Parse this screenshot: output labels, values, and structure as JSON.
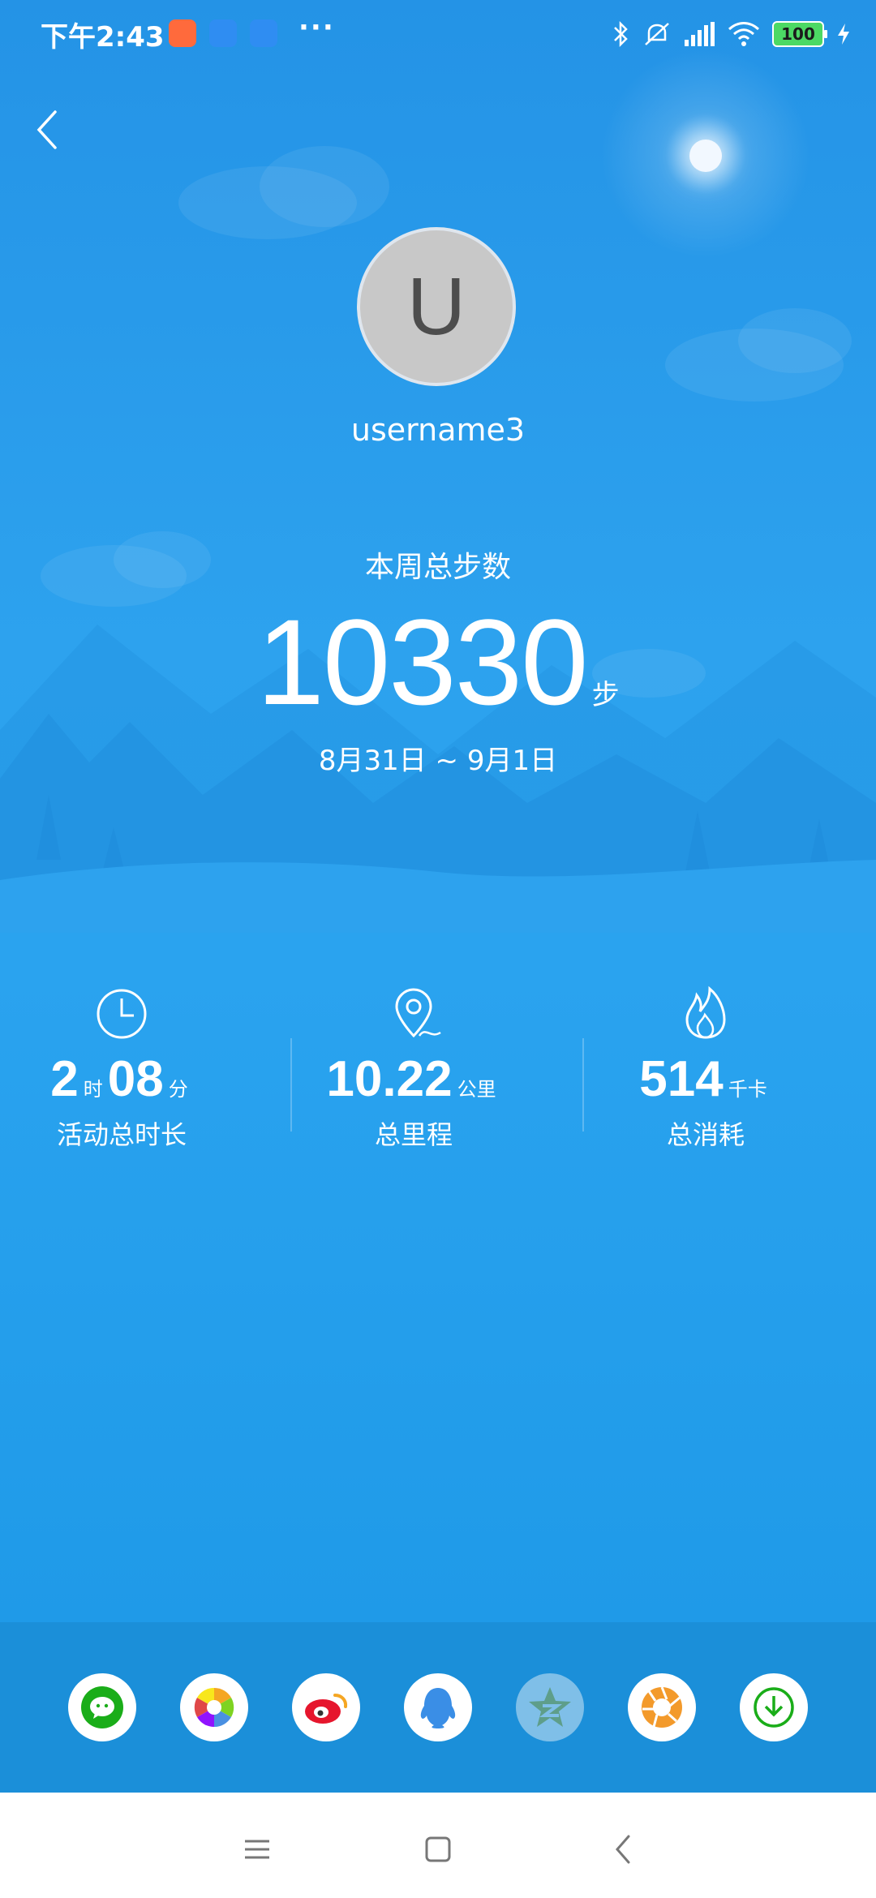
{
  "status_bar": {
    "time": "下午2:43",
    "battery": "100"
  },
  "profile": {
    "avatar_letter": "U",
    "username": "username3"
  },
  "summary": {
    "title": "本周总步数",
    "steps": "10330",
    "steps_unit": "步",
    "date_range": "8月31日 ~ 9月1日"
  },
  "stats": {
    "duration": {
      "hours": "2",
      "hours_unit": "时",
      "minutes": "08",
      "minutes_unit": "分",
      "label": "活动总时长"
    },
    "distance": {
      "value": "10.22",
      "unit": "公里",
      "label": "总里程"
    },
    "calories": {
      "value": "514",
      "unit": "千卡",
      "label": "总消耗"
    }
  },
  "share": [
    "wechat-icon",
    "moments-icon",
    "weibo-icon",
    "qq-icon",
    "qzone-icon",
    "camera-aperture-icon",
    "download-icon"
  ],
  "colors": {
    "background": "#2aa3ef",
    "share_bar": "#1b8fd9",
    "wechat": "#1aad19",
    "weibo": "#e6162d",
    "qq": "#3a8ee6"
  }
}
